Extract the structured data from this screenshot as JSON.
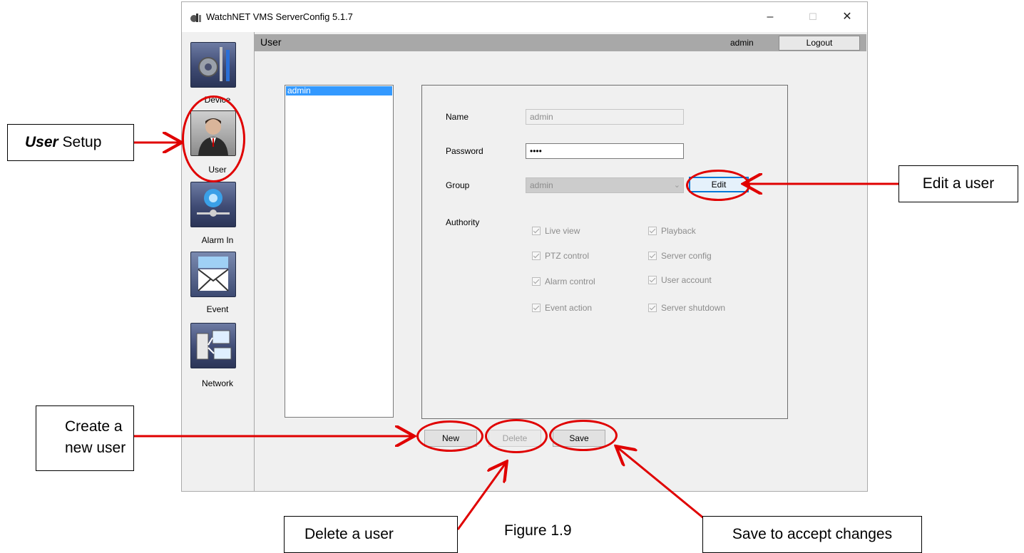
{
  "window": {
    "title": "WatchNET VMS ServerConfig 5.1.7",
    "controls": {
      "minimize": "–",
      "maximize": "☐",
      "close": "✕"
    }
  },
  "sidebar": {
    "items": [
      {
        "label": "Device",
        "icon": "device-tools-icon"
      },
      {
        "label": "User",
        "icon": "user-icon"
      },
      {
        "label": "Alarm In",
        "icon": "alarm-in-icon"
      },
      {
        "label": "Event",
        "icon": "event-mail-icon"
      },
      {
        "label": "Network",
        "icon": "network-icon"
      }
    ]
  },
  "header": {
    "title": "User",
    "username": "admin",
    "logout_label": "Logout"
  },
  "user_list": {
    "items": [
      "admin"
    ]
  },
  "form": {
    "name_label": "Name",
    "name_value": "admin",
    "password_label": "Password",
    "password_value": "••••",
    "group_label": "Group",
    "group_value": "admin",
    "edit_label": "Edit",
    "authority_label": "Authority",
    "authorities": [
      {
        "label": "Live view",
        "checked": true
      },
      {
        "label": "Playback",
        "checked": true
      },
      {
        "label": "PTZ control",
        "checked": true
      },
      {
        "label": "Server config",
        "checked": true
      },
      {
        "label": "Alarm control",
        "checked": true
      },
      {
        "label": "User account",
        "checked": true
      },
      {
        "label": "Event action",
        "checked": true
      },
      {
        "label": "Server shutdown",
        "checked": true
      }
    ]
  },
  "buttons": {
    "new_label": "New",
    "delete_label": "Delete",
    "save_label": "Save"
  },
  "annotations": {
    "user_setup_em": "User",
    "user_setup_rest": " Setup",
    "edit_user": "Edit a user",
    "create_line1": "Create a",
    "create_line2": "new user",
    "delete_user": "Delete a user",
    "save_changes": "Save to accept changes",
    "figure": "Figure 1.9"
  },
  "colors": {
    "annotation_red": "#e00000",
    "selection_blue": "#3399ff",
    "header_gray": "#a8a8a8",
    "edit_focus": "#0078d7"
  }
}
